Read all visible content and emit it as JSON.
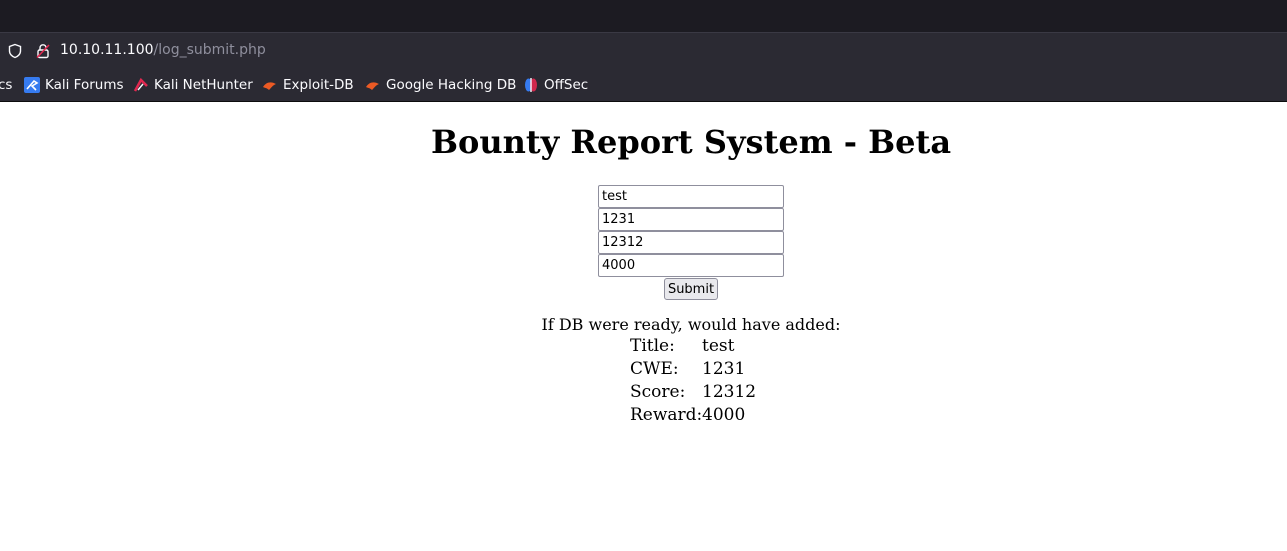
{
  "browser": {
    "url_host": "10.10.11.100",
    "url_path": "/log_submit.php",
    "bookmarks": [
      {
        "label": "cs",
        "icon": "truncated-bookmark"
      },
      {
        "label": "Kali Forums",
        "icon": "kali-forums-icon"
      },
      {
        "label": "Kali NetHunter",
        "icon": "kali-nethunter-icon"
      },
      {
        "label": "Exploit-DB",
        "icon": "exploit-db-icon"
      },
      {
        "label": "Google Hacking DB",
        "icon": "ghdb-icon"
      },
      {
        "label": "OffSec",
        "icon": "offsec-icon"
      }
    ]
  },
  "page": {
    "title": "Bounty Report System - Beta",
    "form": {
      "title_value": "test",
      "cwe_value": "1231",
      "score_value": "12312",
      "reward_value": "4000",
      "submit_label": "Submit"
    },
    "result": {
      "heading": "If DB were ready, would have added:",
      "rows": [
        {
          "label": "Title:",
          "value": "test"
        },
        {
          "label": "CWE:",
          "value": "1231"
        },
        {
          "label": "Score:",
          "value": "12312"
        },
        {
          "label": "Reward:",
          "value": "4000"
        }
      ]
    }
  },
  "colors": {
    "chrome_dark": "#1c1b22",
    "toolbar": "#2b2a33",
    "accent_red": "#e22850",
    "exploit_orange": "#ec5a24"
  }
}
